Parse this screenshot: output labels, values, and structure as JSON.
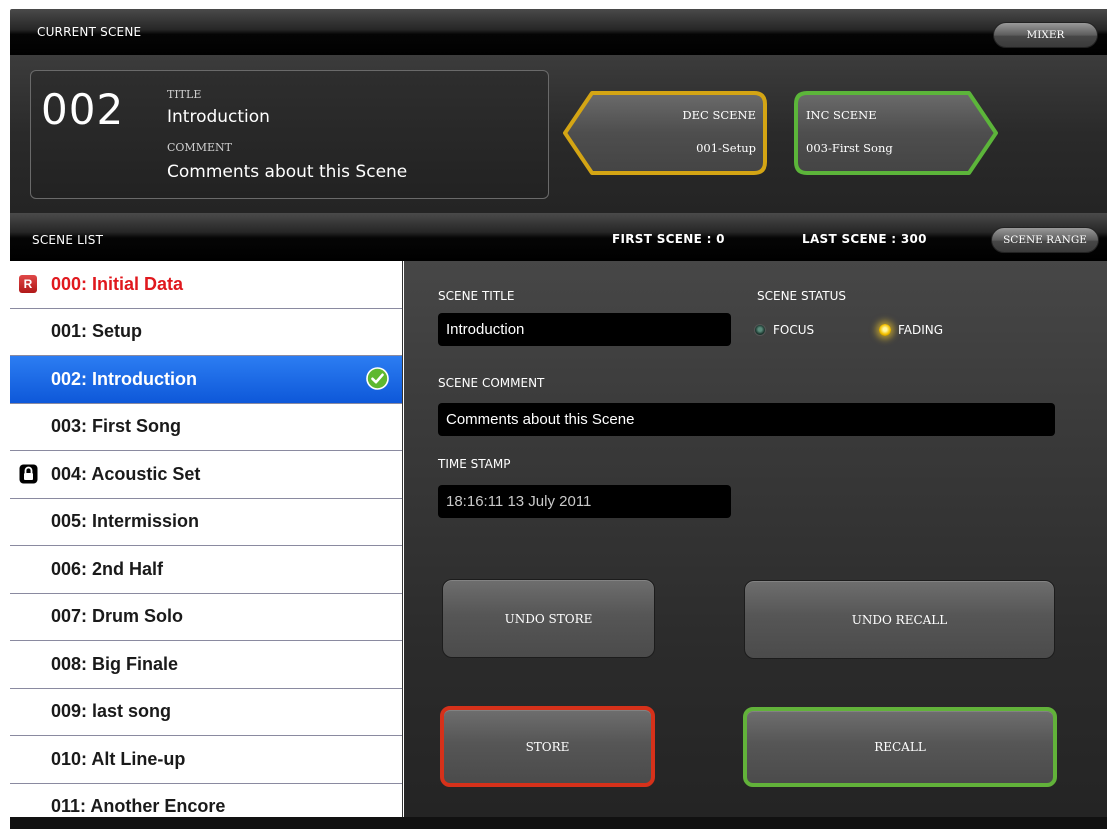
{
  "topbar": {
    "label": "CURRENT SCENE",
    "mixer_button": "MIXER"
  },
  "current_scene": {
    "number": "002",
    "title_label": "TITLE",
    "title": "Introduction",
    "comment_label": "COMMENT",
    "comment": "Comments about this Scene"
  },
  "dec_scene": {
    "label": "DEC SCENE",
    "target": "001-Setup",
    "color": "#d4a514"
  },
  "inc_scene": {
    "label": "INC SCENE",
    "target": "003-First Song",
    "color": "#5cb53a"
  },
  "scene_list_bar": {
    "label": "SCENE LIST",
    "first_scene": "FIRST SCENE : 0",
    "last_scene": "LAST SCENE : 300",
    "range_button": "SCENE RANGE"
  },
  "scene_list": [
    {
      "name": "000: Initial Data",
      "badge": "R",
      "style": "red"
    },
    {
      "name": "001: Setup"
    },
    {
      "name": "002: Introduction",
      "selected": true,
      "icon": "check-icon"
    },
    {
      "name": "003: First Song"
    },
    {
      "name": "004: Acoustic Set",
      "icon": "lock-icon"
    },
    {
      "name": "005: Intermission"
    },
    {
      "name": "006: 2nd Half"
    },
    {
      "name": "007: Drum Solo"
    },
    {
      "name": "008: Big Finale"
    },
    {
      "name": "009: last song"
    },
    {
      "name": "010: Alt Line-up"
    },
    {
      "name": "011: Another Encore"
    }
  ],
  "detail": {
    "scene_title_label": "SCENE TITLE",
    "scene_title_value": "Introduction",
    "scene_status_label": "SCENE STATUS",
    "status_focus": "FOCUS",
    "status_fading": "FADING",
    "scene_comment_label": "SCENE COMMENT",
    "scene_comment_value": "Comments about this Scene",
    "time_stamp_label": "TIME STAMP",
    "time_stamp_value": "18:16:11 13 July 2011"
  },
  "actions": {
    "undo_store": "UNDO STORE",
    "undo_recall": "UNDO RECALL",
    "store": "STORE",
    "recall": "RECALL",
    "store_color": "#d6311a",
    "recall_color": "#62b23a"
  }
}
